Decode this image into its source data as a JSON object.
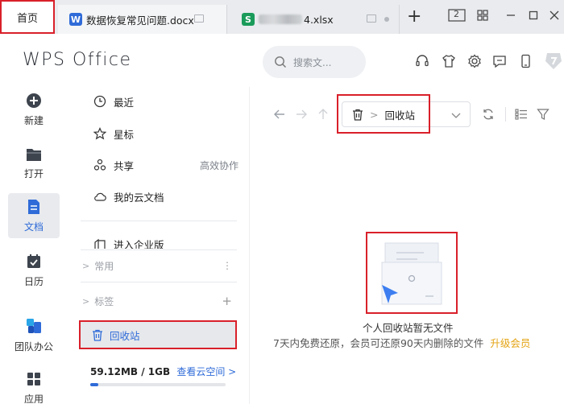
{
  "tabs": {
    "home_label": "首页",
    "doc_tab": {
      "badge": "W",
      "badge_color": "#2f6bd8",
      "label": "数据恢复常见问题.docx"
    },
    "sheet_tab": {
      "badge": "S",
      "badge_color": "#1a9b5a",
      "label": "4.xlsx"
    }
  },
  "window_controls": {
    "page_indicator": "2"
  },
  "header": {
    "logo": "WPS Office",
    "search_placeholder": "搜索文..."
  },
  "left_nav": [
    {
      "label": "新建",
      "icon": "plus-circle-icon"
    },
    {
      "label": "打开",
      "icon": "folder-icon"
    },
    {
      "label": "文档",
      "icon": "document-icon",
      "active": true
    },
    {
      "label": "日历",
      "icon": "calendar-icon"
    },
    {
      "label": "团队办公",
      "icon": "team-icon"
    },
    {
      "label": "应用",
      "icon": "apps-grid-icon"
    }
  ],
  "sidebar": {
    "items": [
      {
        "label": "最近",
        "icon": "clock-icon"
      },
      {
        "label": "星标",
        "icon": "star-icon"
      },
      {
        "label": "共享",
        "icon": "share-icon",
        "extra": "高效协作"
      },
      {
        "label": "我的云文档",
        "icon": "cloud-icon"
      },
      {
        "label": "进入企业版",
        "icon": "enterprise-icon"
      }
    ],
    "groups": [
      {
        "label": "常用",
        "action": "⋮"
      },
      {
        "label": "标签",
        "action": "+"
      }
    ],
    "recycle": {
      "label": "回收站"
    },
    "storage": {
      "text": "59.12MB / 1GB",
      "link": "查看云空间 >",
      "used_fraction": 0.06
    }
  },
  "main": {
    "breadcrumb": {
      "root_icon": "trash-icon",
      "current": "回收站"
    },
    "empty_state": {
      "title": "个人回收站暂无文件",
      "subtitle": "7天内免费还原，会员可还原90天内删除的文件",
      "upgrade_link": "升级会员"
    }
  },
  "colors": {
    "accent": "#2f6bd8",
    "highlight": "#d9202a",
    "upgrade": "#e4a313"
  }
}
